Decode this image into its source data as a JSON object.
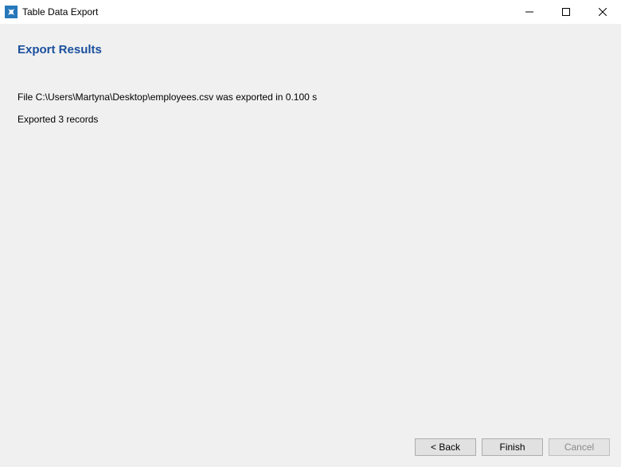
{
  "titlebar": {
    "title": "Table Data Export"
  },
  "content": {
    "heading": "Export Results",
    "status_line_1": "File C:\\Users\\Martyna\\Desktop\\employees.csv was exported in 0.100 s",
    "status_line_2": "Exported 3 records"
  },
  "buttons": {
    "back": "< Back",
    "finish": "Finish",
    "cancel": "Cancel"
  }
}
